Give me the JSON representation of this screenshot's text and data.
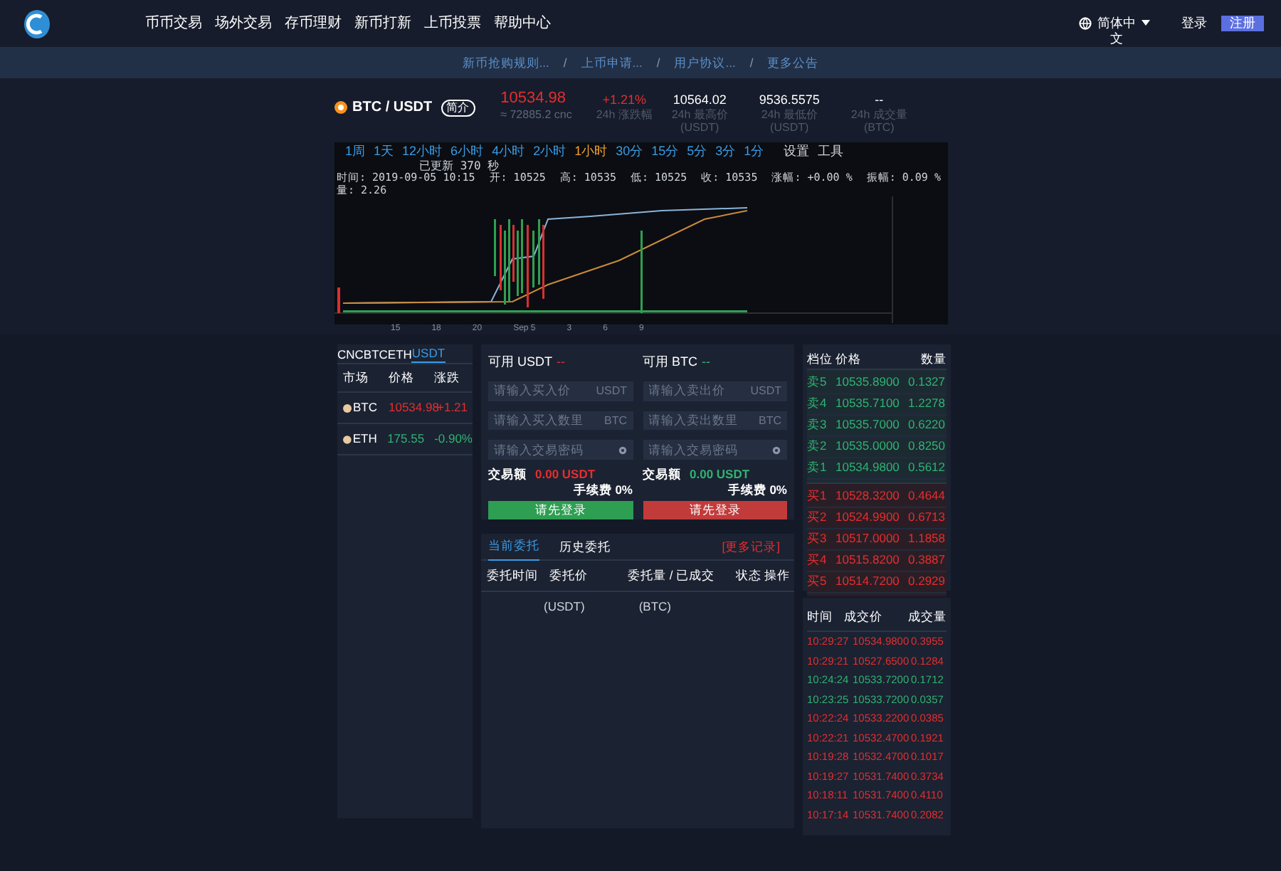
{
  "header": {
    "nav": [
      "币币交易",
      "场外交易",
      "存币理财",
      "新币打新",
      "上币投票",
      "帮助中心"
    ],
    "language": "简体中文",
    "login": "登录",
    "register": "注册"
  },
  "notices": {
    "items": [
      "新币抢购规则...",
      "上币申请...",
      "用户协议...",
      "更多公告"
    ],
    "separators": [
      "/",
      "/",
      "/"
    ]
  },
  "ticker": {
    "pair": "BTC / USDT",
    "intro": "简介",
    "price": "10534.98",
    "price_cny": "≈ 72885.2 cnc",
    "stats": [
      {
        "value": "+1.21%",
        "label": "24h 涨跌幅",
        "rising": true
      },
      {
        "value": "10564.02",
        "label": "24h 最高价 (USDT)"
      },
      {
        "value": "9536.5575",
        "label": "24h 最低价 (USDT)"
      },
      {
        "value": "--",
        "label": "24h 成交量 (BTC)"
      }
    ]
  },
  "chart": {
    "intervals": [
      {
        "label": "1周",
        "selected": false
      },
      {
        "label": "1天",
        "selected": false
      },
      {
        "label": "12小时",
        "selected": false
      },
      {
        "label": "6小时",
        "selected": false
      },
      {
        "label": "4小时",
        "selected": false
      },
      {
        "label": "2小时",
        "selected": false
      },
      {
        "label": "1小时",
        "selected": true
      },
      {
        "label": "30分",
        "selected": false
      },
      {
        "label": "15分",
        "selected": false
      },
      {
        "label": "5分",
        "selected": false
      },
      {
        "label": "3分",
        "selected": false
      },
      {
        "label": "1分",
        "selected": false
      }
    ],
    "tools": [
      "设置",
      "工具"
    ],
    "updated": "已更新 370 秒",
    "info": [
      "时间: 2019-09-05 10:15",
      "开: 10525",
      "高: 10535",
      "低: 10525",
      "收: 10535",
      "涨幅: +0.00 %",
      "振幅: 0.09 %",
      "量: 2.26"
    ],
    "x_labels": [
      "15",
      "18",
      "20",
      "Sep 5",
      "3",
      "6",
      "9"
    ]
  },
  "market": {
    "tabs": [
      {
        "label": "CNC",
        "selected": false
      },
      {
        "label": "BTC",
        "selected": false
      },
      {
        "label": "ETH",
        "selected": false
      },
      {
        "label": "USDT",
        "selected": true
      }
    ],
    "columns": [
      "市场",
      "价格",
      "涨跌"
    ],
    "rows": [
      {
        "coin": "BTC",
        "price": "10534.98",
        "change": "+1.21",
        "rising": true
      },
      {
        "coin": "ETH",
        "price": "175.55",
        "change": "-0.90%",
        "rising": false
      }
    ]
  },
  "trade": [
    {
      "kind": "buy",
      "available": "可用 USDT",
      "available_value": "--",
      "fields": [
        {
          "placeholder": "请输入买入价",
          "unit": "USDT"
        },
        {
          "placeholder": "请输入买入数里",
          "unit": "BTC"
        },
        {
          "placeholder": "请输入交易密码"
        }
      ],
      "amount_label": "交易额",
      "amount": "0.00 USDT",
      "fee": "手续费 0%",
      "button": "请先登录"
    },
    {
      "kind": "sell",
      "available": "可用 BTC",
      "available_value": "--",
      "fields": [
        {
          "placeholder": "请输入卖出价",
          "unit": "USDT"
        },
        {
          "placeholder": "请输入卖出数里",
          "unit": "BTC"
        },
        {
          "placeholder": "请输入交易密码"
        }
      ],
      "amount_label": "交易额",
      "amount": "0.00 USDT",
      "fee": "手续费 0%",
      "button": "请先登录"
    }
  ],
  "orders": {
    "tabs": [
      {
        "label": "当前委托",
        "selected": true
      },
      {
        "label": "历史委托",
        "selected": false
      }
    ],
    "more": "[更多记录]",
    "columns": [
      "委托时间",
      "委托价",
      "委托量 / 已成交",
      "状态",
      "操作"
    ],
    "units": [
      "(USDT)",
      "(BTC)"
    ]
  },
  "orderbook": {
    "columns": [
      "档位",
      "价格",
      "数量"
    ],
    "asks": [
      {
        "level": "卖5",
        "price": "10535.8900",
        "amount": "0.1327"
      },
      {
        "level": "卖4",
        "price": "10535.7100",
        "amount": "1.2278"
      },
      {
        "level": "卖3",
        "price": "10535.7000",
        "amount": "0.6220"
      },
      {
        "level": "卖2",
        "price": "10535.0000",
        "amount": "0.8250"
      },
      {
        "level": "卖1",
        "price": "10534.9800",
        "amount": "0.5612"
      }
    ],
    "bids": [
      {
        "level": "买1",
        "price": "10528.3200",
        "amount": "0.4644"
      },
      {
        "level": "买2",
        "price": "10524.9900",
        "amount": "0.6713"
      },
      {
        "level": "买3",
        "price": "10517.0000",
        "amount": "1.1858"
      },
      {
        "level": "买4",
        "price": "10515.8200",
        "amount": "0.3887"
      },
      {
        "level": "买5",
        "price": "10514.7200",
        "amount": "0.2929"
      }
    ]
  },
  "trades": {
    "columns": [
      "时间",
      "成交价",
      "成交量"
    ],
    "rows": [
      {
        "time": "10:29:27",
        "price": "10534.9800",
        "amount": "0.3955",
        "buy": false
      },
      {
        "time": "10:29:21",
        "price": "10527.6500",
        "amount": "0.1284",
        "buy": false
      },
      {
        "time": "10:24:24",
        "price": "10533.7200",
        "amount": "0.1712",
        "buy": true
      },
      {
        "time": "10:23:25",
        "price": "10533.7200",
        "amount": "0.0357",
        "buy": true
      },
      {
        "time": "10:22:24",
        "price": "10533.2200",
        "amount": "0.0385",
        "buy": false
      },
      {
        "time": "10:22:21",
        "price": "10532.4700",
        "amount": "0.1921",
        "buy": false
      },
      {
        "time": "10:19:28",
        "price": "10532.4700",
        "amount": "0.1017",
        "buy": false
      },
      {
        "time": "10:19:27",
        "price": "10531.7400",
        "amount": "0.3734",
        "buy": false
      },
      {
        "time": "10:18:11",
        "price": "10531.7400",
        "amount": "0.4110",
        "buy": false
      },
      {
        "time": "10:17:14",
        "price": "10531.7400",
        "amount": "0.2082",
        "buy": false
      }
    ]
  }
}
